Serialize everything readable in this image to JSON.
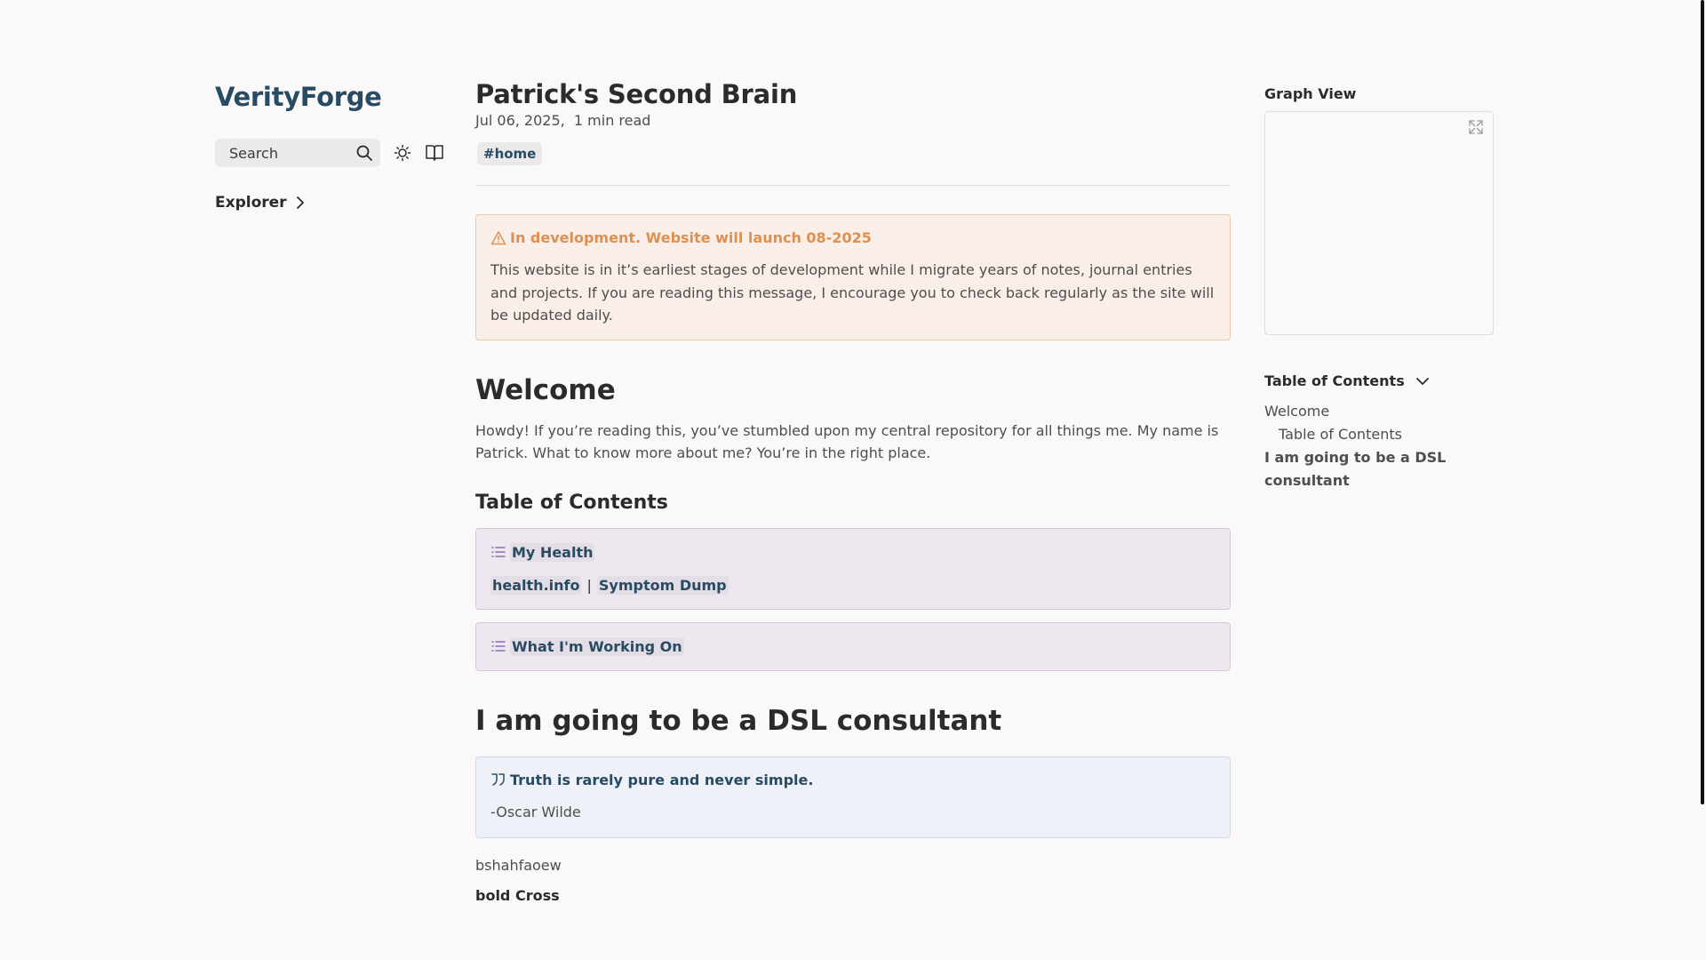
{
  "site": {
    "title": "VerityForge"
  },
  "search": {
    "label": "Search"
  },
  "explorer": {
    "label": "Explorer"
  },
  "page": {
    "title": "Patrick's Second Brain",
    "date": "Jul 06, 2025",
    "read_time": "1 min read",
    "tag": "#home"
  },
  "warning": {
    "title": "In development. Website will launch 08-2025",
    "body": "This website is in it’s earliest stages of development while I migrate years of notes, journal entries and projects. If you are reading this message, I encourage you to check back regularly as the site will be updated daily."
  },
  "welcome": {
    "heading": "Welcome",
    "text": "Howdy! If you’re reading this, you’ve stumbled upon my central repository for all things me. My name is Patrick. What to know more about me? You’re in the right place."
  },
  "toc_section": {
    "heading": "Table of Contents",
    "health": {
      "title": "My Health",
      "links": [
        "health.info",
        "Symptom Dump"
      ],
      "separator": "|"
    },
    "working": {
      "title": "What I'm Working On"
    }
  },
  "dsl": {
    "heading": "I am going to be a DSL consultant",
    "quote_title": "Truth is rarely pure and never simple.",
    "quote_author": "-Oscar Wilde",
    "after_text": "bshahfaoew",
    "bold_text": "bold Cross"
  },
  "right": {
    "graph_title": "Graph View",
    "toc_title": "Table of Contents",
    "toc_items": [
      "Welcome",
      "Table of Contents",
      "I am going to be a DSL consultant"
    ]
  },
  "colors": {
    "accent": "#284b63",
    "warning": "#e08f4e",
    "background": "#faf8f8"
  }
}
